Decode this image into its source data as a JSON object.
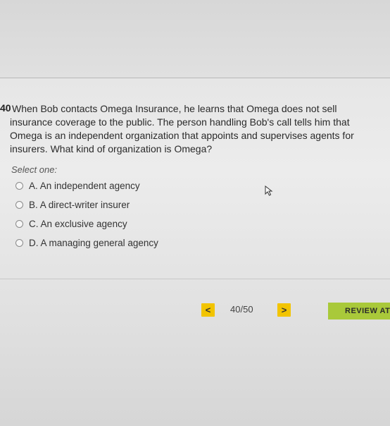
{
  "question": {
    "number": "40",
    "text_lines": [
      "When Bob contacts Omega Insurance, he learns that Omega does not sell",
      "insurance coverage to the public. The person handling Bob's call tells him that",
      "Omega is an independent organization that appoints and supervises agents for",
      "insurers. What kind of organization is Omega?"
    ],
    "prompt": "Select one:",
    "options": [
      {
        "label": "A. An independent agency",
        "selected": false
      },
      {
        "label": "B. A direct-writer insurer",
        "selected": false
      },
      {
        "label": "C. An exclusive agency",
        "selected": false
      },
      {
        "label": "D. A managing general agency",
        "selected": false
      }
    ]
  },
  "navigation": {
    "prev_label": "<",
    "next_label": ">",
    "current_page": "40",
    "separator": "/",
    "total_pages": "50",
    "review_label": "REVIEW AT"
  },
  "colors": {
    "nav_button": "#f2c400",
    "review_button": "#a9c93a"
  }
}
